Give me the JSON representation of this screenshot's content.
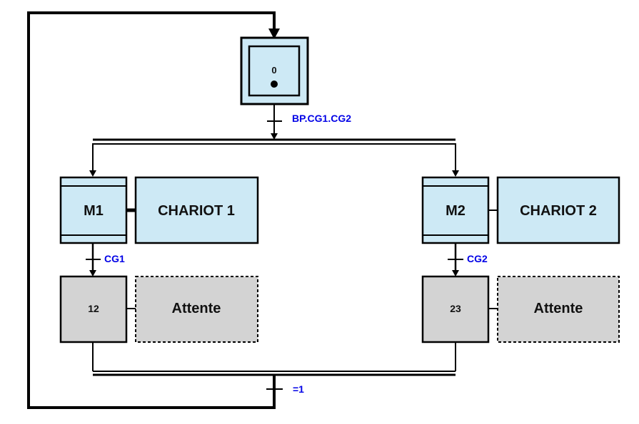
{
  "diagram": {
    "type": "grafcet",
    "colors": {
      "step_fill": "#cde9f5",
      "wait_fill": "#d3d3d3",
      "line": "#000000",
      "condition": "#0000e6"
    },
    "initial_step": {
      "label": "0",
      "active_token": true
    },
    "transitions": {
      "t0": "BP.CG1.CG2",
      "t_left": "CG1",
      "t_right": "CG2",
      "t_end": "=1"
    },
    "branches": [
      {
        "macro_step": "M1",
        "action": "CHARIOT 1",
        "wait_step": "12",
        "wait_action": "Attente"
      },
      {
        "macro_step": "M2",
        "action": "CHARIOT 2",
        "wait_step": "23",
        "wait_action": "Attente"
      }
    ]
  }
}
